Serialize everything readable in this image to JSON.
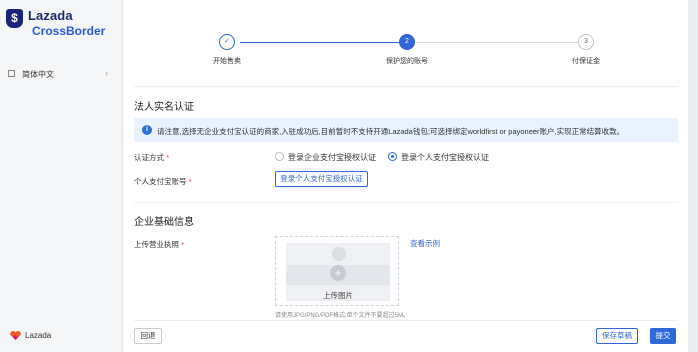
{
  "brand": {
    "name": "Lazada",
    "sub": "CrossBorder",
    "mark": "$"
  },
  "sidebar": {
    "language": "简体中文",
    "bottom_brand": "Lazada"
  },
  "stepper": {
    "steps": [
      {
        "index": "✓",
        "label": "开始售卖",
        "state": "done"
      },
      {
        "index": "2",
        "label": "保护您的账号",
        "state": "active"
      },
      {
        "index": "3",
        "label": "付保证金",
        "state": "pending"
      }
    ]
  },
  "section1": {
    "title": "法人实名认证",
    "notice": "请注意,选择无企业支付宝认证的商家,入驻成功后,目前暂时不支持开通Lazada钱包;可选择绑定worldfirst or payoneer账户,实现正常结算收款。",
    "auth_method_label": "认证方式",
    "options": [
      "登录企业支付宝授权认证",
      "登录个人支付宝授权认证"
    ],
    "selected_option": "登录个人支付宝授权认证",
    "account_label": "个人支付宝账号",
    "auth_button": "登录个人支付宝授权认证"
  },
  "section2": {
    "title": "企业基础信息",
    "license_label": "上传营业执照",
    "upload_text": "上传图片",
    "sample_link": "查看示例",
    "hint": "请使用JPG/PNG/PDF格式,单个文件不要超过5M。"
  },
  "footer": {
    "back": "回退",
    "save_draft": "保存草稿",
    "submit": "提交"
  },
  "colors": {
    "accent": "#3066d6",
    "notice_bg": "#e8f3ff",
    "required": "#e03c3c"
  }
}
